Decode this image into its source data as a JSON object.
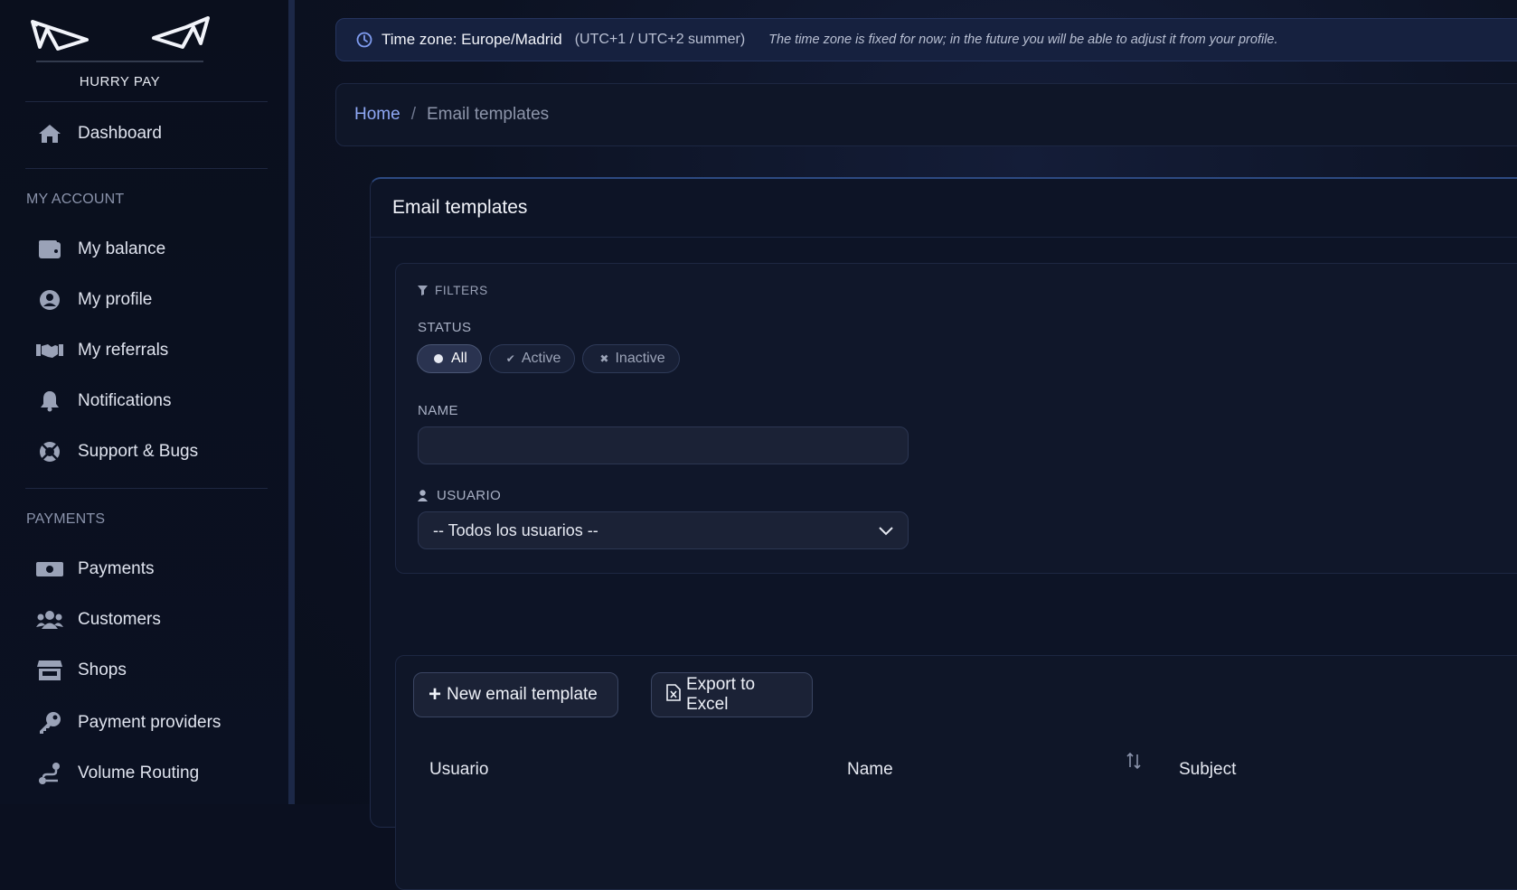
{
  "brand": {
    "name": "HURRY PAY"
  },
  "sidebar": {
    "dashboard": {
      "label": "Dashboard",
      "icon": "home-icon"
    },
    "sections": [
      {
        "title": "MY ACCOUNT"
      },
      {
        "title": "PAYMENTS"
      }
    ],
    "account_items": [
      {
        "label": "My balance",
        "icon": "wallet-icon"
      },
      {
        "label": "My profile",
        "icon": "user-circle-icon"
      },
      {
        "label": "My referrals",
        "icon": "handshake-icon"
      },
      {
        "label": "Notifications",
        "icon": "bell-icon"
      },
      {
        "label": "Support & Bugs",
        "icon": "lifebuoy-icon"
      }
    ],
    "payment_items": [
      {
        "label": "Payments",
        "icon": "money-bill-icon"
      },
      {
        "label": "Customers",
        "icon": "users-icon"
      },
      {
        "label": "Shops",
        "icon": "store-icon"
      },
      {
        "label": "Payment providers",
        "icon": "key-icon"
      },
      {
        "label": "Volume Routing",
        "icon": "route-icon"
      }
    ]
  },
  "timezone": {
    "title": "Time zone: Europe/Madrid",
    "offset": "(UTC+1 / UTC+2 summer)",
    "note": "The time zone is fixed for now; in the future you will be able to adjust it from your profile."
  },
  "breadcrumb": {
    "home": "Home",
    "separator": "/",
    "current": "Email templates"
  },
  "card": {
    "title": "Email templates"
  },
  "filters": {
    "heading": "FILTERS",
    "status_label": "STATUS",
    "status_options": [
      "All",
      "Active",
      "Inactive"
    ],
    "status_selected": "All",
    "name_label": "NAME",
    "name_value": "",
    "user_label": "USUARIO",
    "user_selected": "-- Todos los usuarios --"
  },
  "actions": {
    "new_label": "New email template",
    "export_label": "Export to Excel"
  },
  "table": {
    "columns": [
      "Usuario",
      "Name",
      "Subject"
    ]
  },
  "colors": {
    "accent_link": "#8fa8f5",
    "background": "#0b1020",
    "banner": "#16213f"
  }
}
